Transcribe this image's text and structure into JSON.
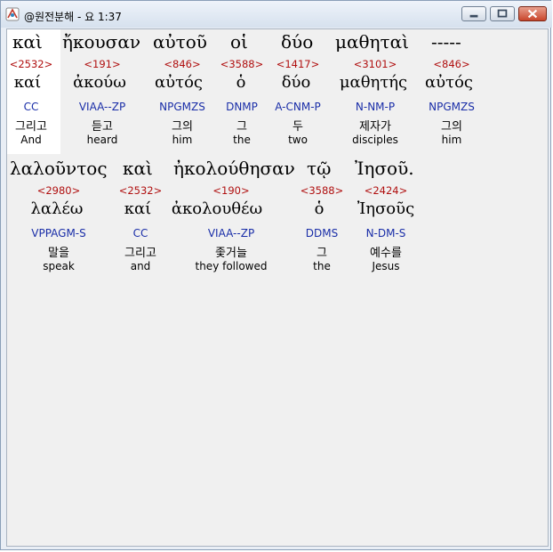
{
  "window": {
    "title": "@원전분해 - 요 1:37",
    "app_icon": "app-diagram-icon",
    "controls": [
      "minimize-icon",
      "maximize-icon",
      "close-icon"
    ]
  },
  "verse": {
    "line1": [
      {
        "orig": "καὶ",
        "num": "<2532>",
        "lemma": "καί",
        "parse": "CC",
        "ko": "그리고",
        "en": "And"
      },
      {
        "orig": "ἤκουσαν",
        "num": "<191>",
        "lemma": "ἀκούω",
        "parse": "VIAA--ZP",
        "ko": "듣고",
        "en": "heard"
      },
      {
        "orig": "αὐτοῦ",
        "num": "<846>",
        "lemma": "αὐτός",
        "parse": "NPGMZS",
        "ko": "그의",
        "en": "him"
      },
      {
        "orig": "οἱ",
        "num": "<3588>",
        "lemma": "ὁ",
        "parse": "DNMP",
        "ko": "그",
        "en": "the"
      },
      {
        "orig": "δύο",
        "num": "<1417>",
        "lemma": "δύο",
        "parse": "A-CNM-P",
        "ko": "두",
        "en": "two"
      },
      {
        "orig": "μαθηταὶ",
        "num": "<3101>",
        "lemma": "μαθητής",
        "parse": "N-NM-P",
        "ko": "제자가",
        "en": "disciples"
      },
      {
        "orig": "-----",
        "num": "<846>",
        "lemma": "αὐτός",
        "parse": "NPGMZS",
        "ko": "그의",
        "en": "him"
      }
    ],
    "line2": [
      {
        "orig": "λαλοῦντος",
        "num": "<2980>",
        "lemma": "λαλέω",
        "parse": "VPPAGM-S",
        "ko": "말을",
        "en": "speak"
      },
      {
        "orig": "καὶ",
        "num": "<2532>",
        "lemma": "καί",
        "parse": "CC",
        "ko": "그리고",
        "en": "and"
      },
      {
        "orig": "ἠκολούθησαν",
        "num": "<190>",
        "lemma": "ἀκολουθέω",
        "parse": "VIAA--ZP",
        "ko": "좇거늘",
        "en": "they followed"
      },
      {
        "orig": "τῷ",
        "num": "<3588>",
        "lemma": "ὁ",
        "parse": "DDMS",
        "ko": "그",
        "en": "the"
      },
      {
        "orig": "Ἰησοῦ.",
        "num": "<2424>",
        "lemma": "Ἰησοῦς",
        "parse": "N-DM-S",
        "ko": "예수를",
        "en": "Jesus"
      }
    ]
  }
}
